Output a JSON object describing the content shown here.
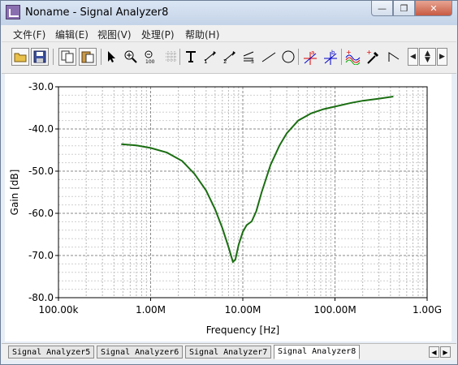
{
  "window": {
    "title": "Noname - Signal Analyzer8"
  },
  "menu": [
    {
      "label": "文件(F)"
    },
    {
      "label": "编辑(E)"
    },
    {
      "label": "视图(V)"
    },
    {
      "label": "处理(P)"
    },
    {
      "label": "帮助(H)"
    }
  ],
  "toolbar": {
    "icons": [
      "open-folder-icon",
      "save-icon",
      "copy-icon",
      "paste-icon",
      "pointer-icon",
      "zoom-in-icon",
      "zoom-100-icon",
      "grid-icon",
      "text-icon",
      "annotate-1-icon",
      "annotate-2-icon",
      "annotate-3-icon",
      "line-icon",
      "circle-icon",
      "cursor-a-icon",
      "cursor-b-icon",
      "waveform-icon",
      "probe-icon",
      "slope-icon"
    ]
  },
  "tabs": [
    {
      "label": "Signal Analyzer5",
      "active": false
    },
    {
      "label": "Signal Analyzer6",
      "active": false
    },
    {
      "label": "Signal Analyzer7",
      "active": false
    },
    {
      "label": "Signal Analyzer8",
      "active": true
    }
  ],
  "chart_data": {
    "type": "line",
    "xlabel": "Frequency [Hz]",
    "ylabel": "Gain [dB]",
    "x_scale": "log",
    "xlim": [
      100000,
      1000000000
    ],
    "ylim": [
      -80,
      -30
    ],
    "x_tick_labels": [
      "100.00k",
      "1.00M",
      "10.00M",
      "100.00M",
      "1.00G"
    ],
    "y_tick_labels": [
      "-30.0",
      "-40.0",
      "-50.0",
      "-60.0",
      "-70.0",
      "-80.0"
    ],
    "y_ticks": [
      -30,
      -40,
      -50,
      -60,
      -70,
      -80
    ],
    "x_ticks": [
      100000,
      1000000,
      10000000,
      100000000,
      1000000000
    ],
    "grid": true,
    "line_color": "#1b6e12",
    "series": [
      {
        "x": [
          480000,
          700000,
          1000000,
          1500000,
          2200000,
          3000000,
          4000000,
          5000000,
          6000000,
          7000000,
          7800000,
          8300000,
          9000000,
          10000000,
          11000000,
          12500000,
          14000000,
          16000000,
          20000000,
          25000000,
          30000000,
          40000000,
          55000000,
          75000000,
          100000000,
          150000000,
          200000000,
          300000000,
          430000000
        ],
        "y": [
          -43.6,
          -43.9,
          -44.5,
          -45.6,
          -47.6,
          -50.7,
          -54.6,
          -59.0,
          -63.5,
          -68.0,
          -71.5,
          -71.0,
          -67.5,
          -64.4,
          -62.8,
          -61.9,
          -59.5,
          -55.0,
          -48.5,
          -43.9,
          -41.0,
          -38.0,
          -36.3,
          -35.3,
          -34.7,
          -33.8,
          -33.3,
          -32.8,
          -32.3
        ]
      }
    ]
  }
}
